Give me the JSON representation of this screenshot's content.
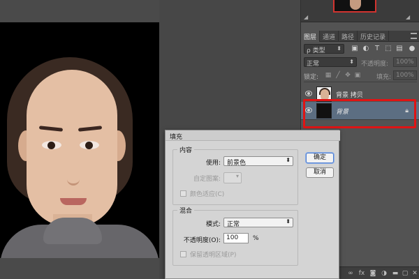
{
  "layers_panel": {
    "tabs": [
      "图层",
      "通道",
      "路径",
      "历史记录"
    ],
    "filter_kind": "ρ 类型",
    "blend_mode": "正常",
    "opacity_label": "不透明度:",
    "opacity_value": "100%",
    "lock_label": "锁定:",
    "fill_label": "填充:",
    "fill_value": "100%",
    "layers": [
      {
        "name": "背景 拷贝",
        "selected": false,
        "locked": false
      },
      {
        "name": "背景",
        "selected": true,
        "locked": true
      }
    ],
    "selected_layer_color": "#5c6e82",
    "highlight_color": "#e01414"
  },
  "fill_dialog": {
    "title": "填充",
    "content_group_title": "内容",
    "use_label": "使用:",
    "use_value": "前景色",
    "custom_pattern_label": "自定图案:",
    "color_adapt_label": "颜色适应(C)",
    "blend_group_title": "混合",
    "mode_label": "模式:",
    "mode_value": "正常",
    "opacity_label": "不透明度(O):",
    "opacity_value": "100",
    "opacity_unit": "%",
    "preserve_transparency_label": "保留透明区域(P)",
    "ok_label": "确定",
    "cancel_label": "取消"
  }
}
